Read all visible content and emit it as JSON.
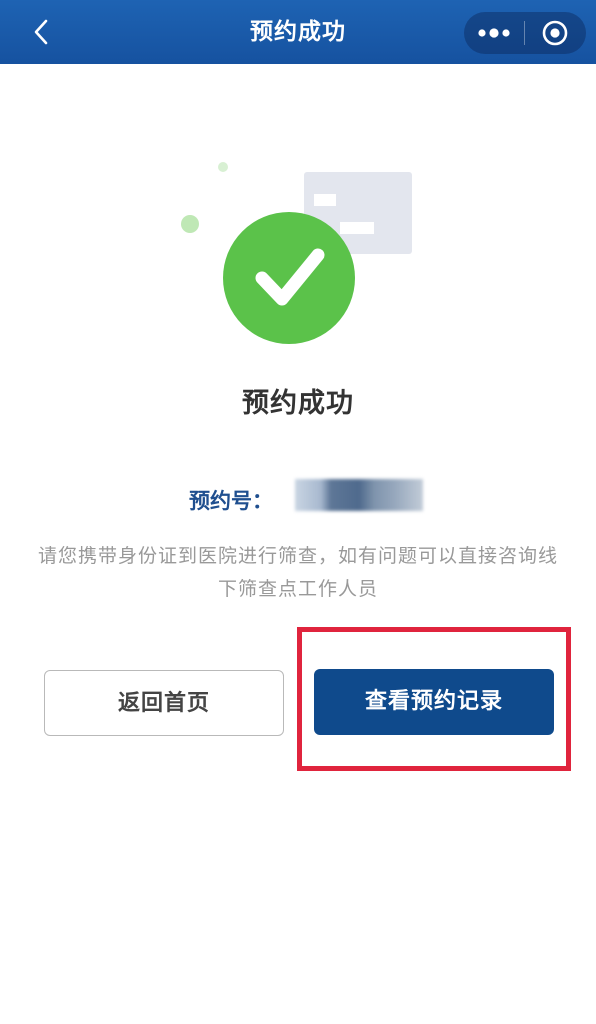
{
  "nav": {
    "title": "预约成功",
    "back_icon": "chevron-left-icon",
    "more_icon": "more-dots-icon",
    "close_icon": "target-circle-icon",
    "background": "#1652a0"
  },
  "main": {
    "illustration_icon": "success-check-icon",
    "success_color": "#5bc24a",
    "title": "预约成功",
    "booking_label": "预约号：",
    "booking_number_redacted": true,
    "notice": "请您携带身份证到医院进行筛查，如有问题可以直接咨询线下筛查点工作人员"
  },
  "actions": {
    "home_label": "返回首页",
    "records_label": "查看预约记录",
    "primary_color": "#0f4a8c",
    "highlight_color": "#e0243d"
  }
}
